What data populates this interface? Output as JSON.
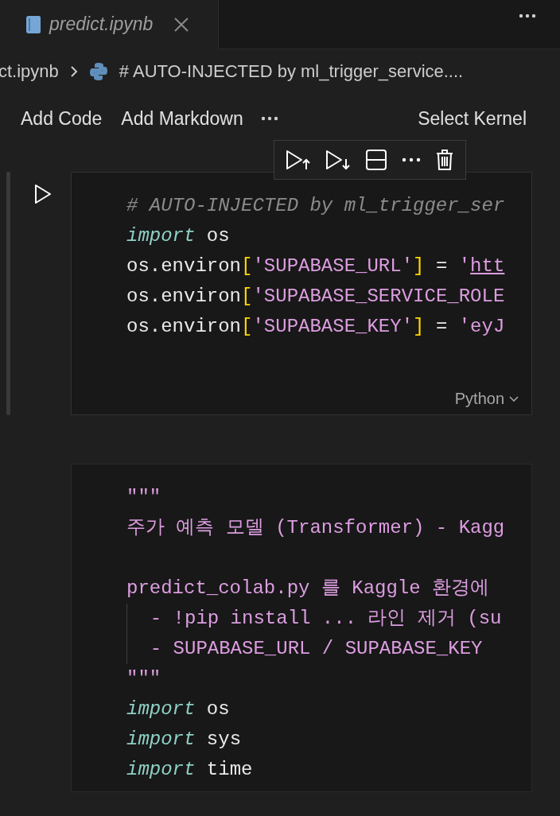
{
  "tab": {
    "title": "predict.ipynb",
    "selected": true
  },
  "breadcrumb": {
    "file": "ct.ipynb",
    "cell": "# AUTO-INJECTED by ml_trigger_service...."
  },
  "toolbar": {
    "buttons": [
      "Add Code",
      "Add Markdown"
    ],
    "kernel": "Select Kernel"
  },
  "cells": [
    {
      "focused": true,
      "language": "Python",
      "lines": [
        {
          "kind": "code",
          "indent_guide": false,
          "tokens": [
            {
              "kind": "comment",
              "text": "# AUTO-INJECTED by ml_trigger_ser"
            }
          ]
        },
        {
          "kind": "code",
          "indent_guide": false,
          "tokens": [
            {
              "kind": "keyword",
              "text": "import"
            },
            {
              "kind": "plain",
              "text": " os"
            }
          ]
        },
        {
          "kind": "code",
          "indent_guide": false,
          "tokens": [
            {
              "kind": "plain",
              "text": "os.environ"
            },
            {
              "kind": "bracket",
              "text": "["
            },
            {
              "kind": "string",
              "text": "'SUPABASE_URL'"
            },
            {
              "kind": "bracket",
              "text": "]"
            },
            {
              "kind": "plain",
              "text": " = "
            },
            {
              "kind": "string",
              "text": "'"
            },
            {
              "kind": "link",
              "text": "htt"
            }
          ]
        },
        {
          "kind": "code",
          "indent_guide": false,
          "tokens": [
            {
              "kind": "plain",
              "text": "os.environ"
            },
            {
              "kind": "bracket",
              "text": "["
            },
            {
              "kind": "string",
              "text": "'SUPABASE_SERVICE_ROLE"
            }
          ]
        },
        {
          "kind": "code",
          "indent_guide": false,
          "tokens": [
            {
              "kind": "plain",
              "text": "os.environ"
            },
            {
              "kind": "bracket",
              "text": "["
            },
            {
              "kind": "string",
              "text": "'SUPABASE_KEY'"
            },
            {
              "kind": "bracket",
              "text": "]"
            },
            {
              "kind": "plain",
              "text": " = "
            },
            {
              "kind": "string",
              "text": "'eyJ"
            }
          ]
        }
      ]
    },
    {
      "focused": false,
      "lines": [
        {
          "kind": "code",
          "indent_guide": false,
          "tokens": [
            {
              "kind": "string",
              "text": "\"\"\""
            }
          ]
        },
        {
          "kind": "code",
          "indent_guide": false,
          "tokens": [
            {
              "kind": "string",
              "text": "주가 예측 모델 (Transformer) - Kagg"
            }
          ]
        },
        {
          "kind": "blank"
        },
        {
          "kind": "code",
          "indent_guide": false,
          "tokens": [
            {
              "kind": "string",
              "text": "predict_colab.py 를 Kaggle 환경에"
            }
          ]
        },
        {
          "kind": "code",
          "indent_guide": true,
          "tokens": [
            {
              "kind": "string",
              "text": "  - !pip install ... 라인 제거 (su"
            }
          ]
        },
        {
          "kind": "code",
          "indent_guide": true,
          "tokens": [
            {
              "kind": "string",
              "text": "  - SUPABASE_URL / SUPABASE_KEY"
            }
          ]
        },
        {
          "kind": "code",
          "indent_guide": false,
          "tokens": [
            {
              "kind": "string",
              "text": "\"\"\""
            }
          ]
        },
        {
          "kind": "code",
          "indent_guide": false,
          "tokens": [
            {
              "kind": "keyword",
              "text": "import"
            },
            {
              "kind": "plain",
              "text": " os"
            }
          ]
        },
        {
          "kind": "code",
          "indent_guide": false,
          "tokens": [
            {
              "kind": "keyword",
              "text": "import"
            },
            {
              "kind": "plain",
              "text": " sys"
            }
          ]
        },
        {
          "kind": "code",
          "indent_guide": false,
          "tokens": [
            {
              "kind": "keyword",
              "text": "import"
            },
            {
              "kind": "plain",
              "text": " time"
            }
          ]
        }
      ]
    }
  ]
}
